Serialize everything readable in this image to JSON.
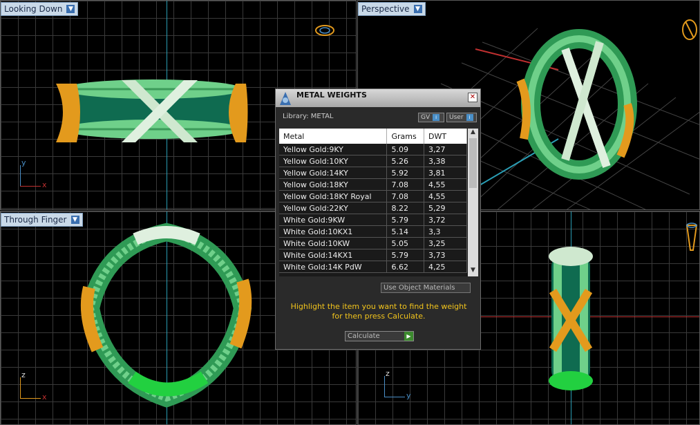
{
  "viewports": {
    "top_left": {
      "label": "Looking Down"
    },
    "top_right": {
      "label": "Perspective"
    },
    "bottom_left": {
      "label": "Through Finger"
    },
    "bottom_right": {
      "label": ""
    }
  },
  "axis_labels": {
    "x": "x",
    "y": "y",
    "z": "z"
  },
  "panel": {
    "title": "METAL WEIGHTS",
    "library_label": "Library: METAL",
    "gv_label": "GV",
    "user_label": "User",
    "columns": [
      "Metal",
      "Grams",
      "DWT"
    ],
    "rows": [
      [
        "Yellow Gold:9KY",
        "5.09",
        "3,27"
      ],
      [
        "Yellow Gold:10KY",
        "5.26",
        "3,38"
      ],
      [
        "Yellow Gold:14KY",
        "5.92",
        "3,81"
      ],
      [
        "Yellow Gold:18KY",
        "7.08",
        "4,55"
      ],
      [
        "Yellow Gold:18KY Royal",
        "7.08",
        "4,55"
      ],
      [
        "Yellow Gold:22KY",
        "8.22",
        "5,29"
      ],
      [
        "White Gold:9KW",
        "5.79",
        "3,72"
      ],
      [
        "White Gold:10KX1",
        "5.14",
        "3,3"
      ],
      [
        "White Gold:10KW",
        "5.05",
        "3,25"
      ],
      [
        "White Gold:14KX1",
        "5.79",
        "3,73"
      ],
      [
        "White Gold:14K PdW",
        "6.62",
        "4,25"
      ]
    ],
    "use_object_label": "Use Object Materials",
    "hint_text": "Highlight the item you want to find the weight for then press Calculate.",
    "calculate_label": "Calculate"
  },
  "colors": {
    "accent": "#f2c41c",
    "green_ring": "#4fb96a",
    "gold": "#e39a1d",
    "grid": "#3a3a3a"
  }
}
